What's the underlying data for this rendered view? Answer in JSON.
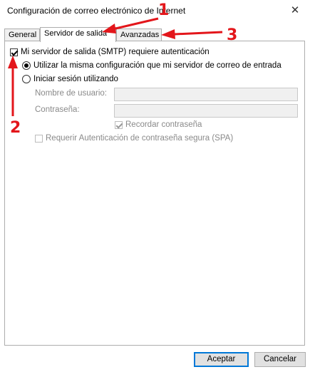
{
  "window": {
    "title": "Configuración de correo electrónico de Internet",
    "close_glyph": "✕"
  },
  "tabs": [
    {
      "label": "General",
      "active": false
    },
    {
      "label": "Servidor de salida",
      "active": true
    },
    {
      "label": "Avanzadas",
      "active": false
    }
  ],
  "smtp": {
    "auth_label": "Mi servidor de salida (SMTP) requiere autenticación",
    "auth_checked": true,
    "option_same_label": "Utilizar la misma configuración que mi servidor de correo de entrada",
    "option_same_selected": true,
    "option_login_label": "Iniciar sesión utilizando",
    "option_login_selected": false,
    "username_label": "Nombre de usuario:",
    "username_value": "",
    "password_label": "Contraseña:",
    "password_value": "",
    "remember_label": "Recordar contraseña",
    "remember_checked": true,
    "spa_label": "Requerir Autenticación de contraseña segura (SPA)",
    "spa_checked": false
  },
  "buttons": {
    "accept": "Aceptar",
    "cancel": "Cancelar"
  },
  "annotations": {
    "marker_1": "1",
    "marker_2": "2",
    "marker_3": "3",
    "color": "#e3161b"
  }
}
